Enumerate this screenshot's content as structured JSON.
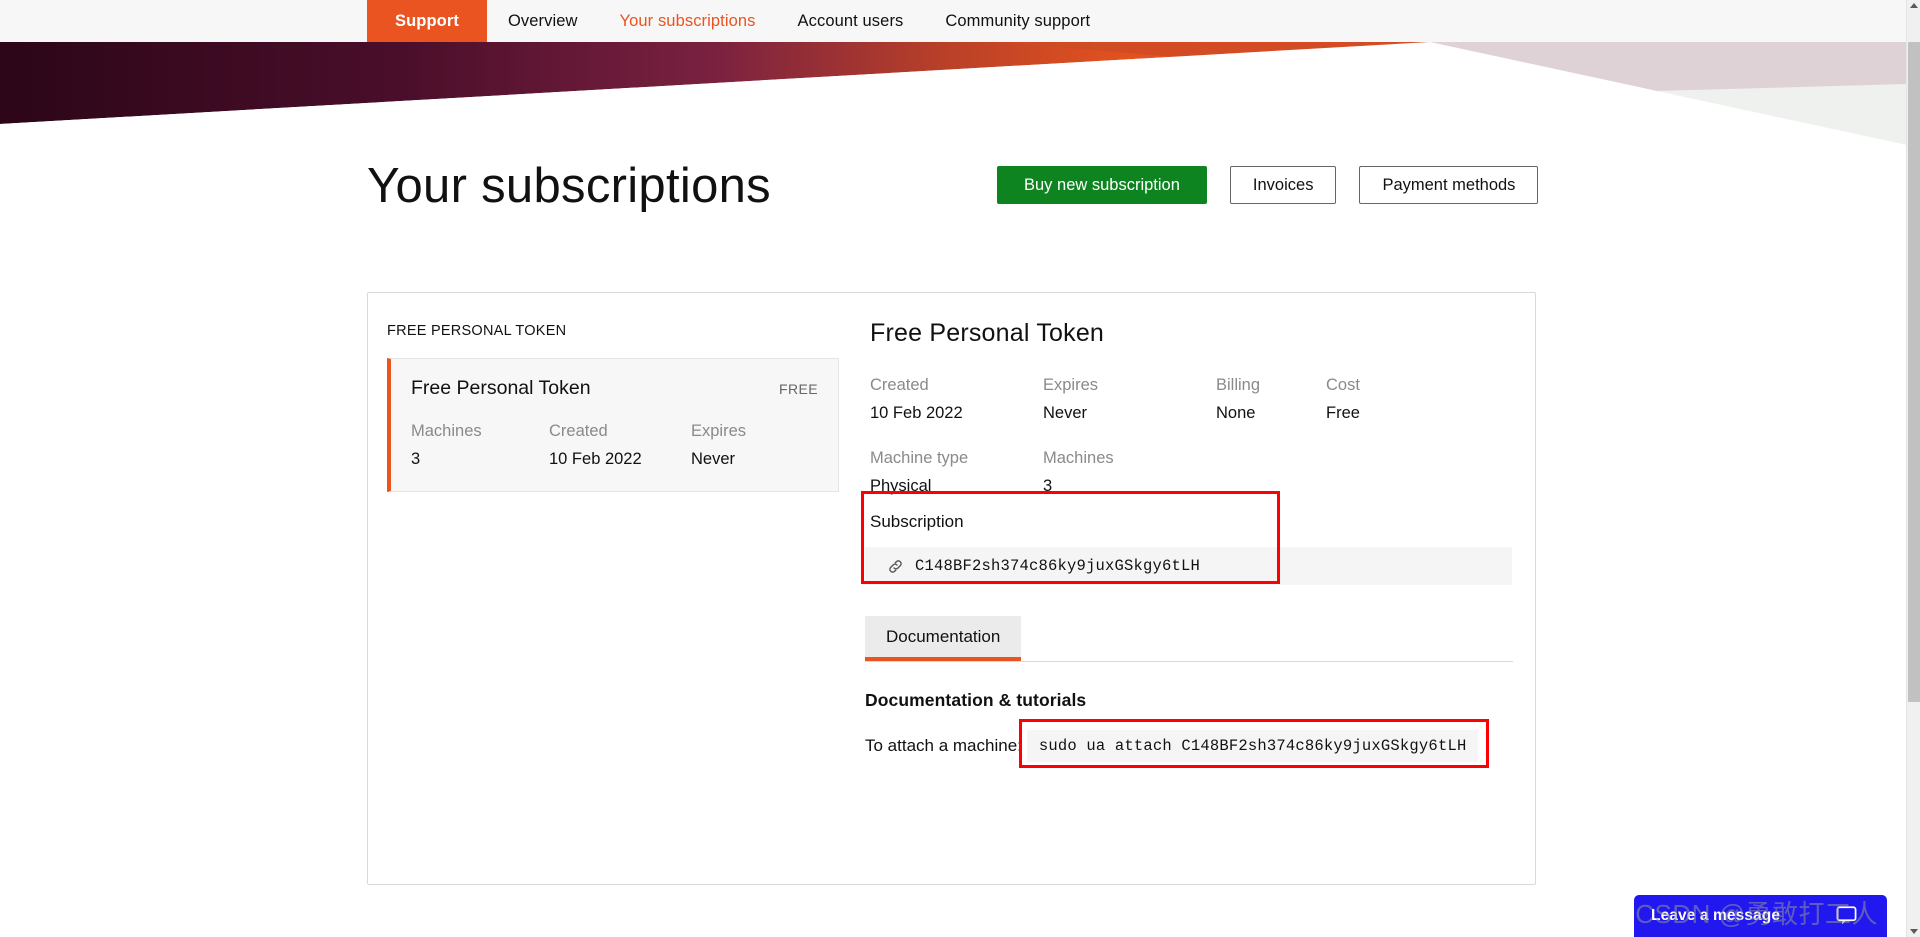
{
  "nav": {
    "brand_label": "Support",
    "items": [
      {
        "label": "Overview",
        "state": "default"
      },
      {
        "label": "Your subscriptions",
        "state": "current"
      },
      {
        "label": "Account users",
        "state": "default"
      },
      {
        "label": "Community support",
        "state": "default"
      }
    ]
  },
  "header": {
    "title": "Your subscriptions",
    "buttons": {
      "buy": "Buy new subscription",
      "invoices": "Invoices",
      "payment_methods": "Payment methods"
    }
  },
  "sidebar": {
    "group_label": "FREE PERSONAL TOKEN",
    "card": {
      "title": "Free Personal Token",
      "badge": "FREE",
      "fields": [
        {
          "key": "Machines",
          "value": "3"
        },
        {
          "key": "Created",
          "value": "10 Feb 2022"
        },
        {
          "key": "Expires",
          "value": "Never"
        }
      ]
    }
  },
  "detail": {
    "title": "Free Personal Token",
    "row1": [
      {
        "key": "Created",
        "value": "10 Feb 2022"
      },
      {
        "key": "Expires",
        "value": "Never"
      },
      {
        "key": "Billing",
        "value": "None"
      },
      {
        "key": "Cost",
        "value": "Free"
      }
    ],
    "row2": [
      {
        "key": "Machine type",
        "value": "Physical"
      },
      {
        "key": "Machines",
        "value": "3"
      }
    ],
    "subscription": {
      "label": "Subscription",
      "token": "C148BF2sh374c86ky9juxGSkgy6tLH"
    },
    "tabs": [
      {
        "label": "Documentation",
        "active": true
      }
    ],
    "documentation": {
      "heading": "Documentation & tutorials",
      "attach_label": "To attach a machine:",
      "attach_command": "sudo ua attach C148BF2sh374c86ky9juxGSkgy6tLH"
    }
  },
  "chat": {
    "label": "Leave a message"
  },
  "watermark": {
    "text": "CSDN @勇敢打工人"
  },
  "colors": {
    "ubuntu_orange": "#e95420",
    "green_cta": "#0e8420",
    "highlight_red": "#ff0000",
    "chat_blue": "#2118ef",
    "banner_dark": "#2c0618"
  }
}
